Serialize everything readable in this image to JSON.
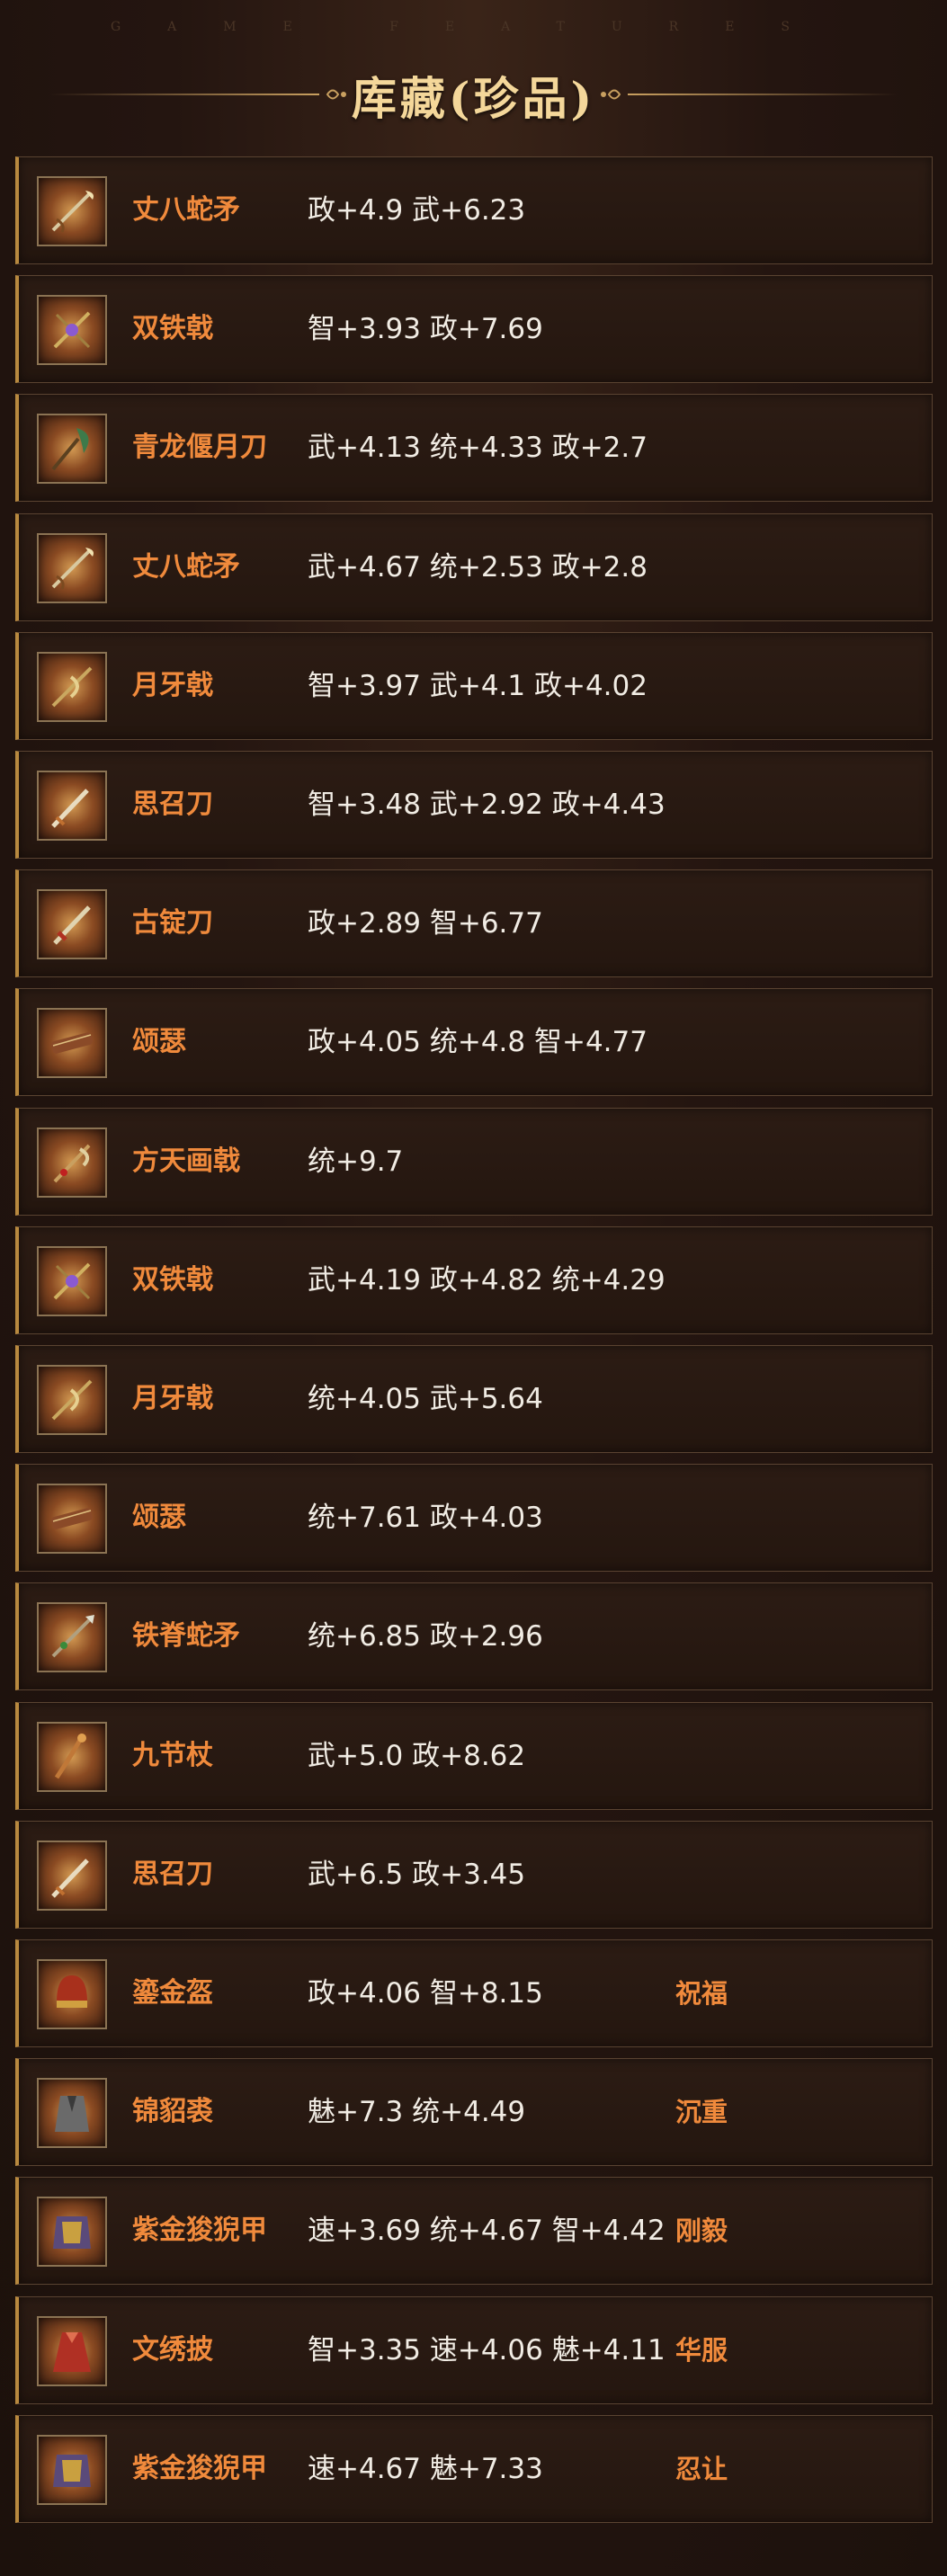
{
  "header": {
    "subtitle": "GAME FEATURES",
    "title": "库藏(珍品)"
  },
  "items": [
    {
      "icon": "snake-spear-icon",
      "name": "丈八蛇矛",
      "stats": "政+4.9 武+6.23",
      "trait": ""
    },
    {
      "icon": "double-halberd-icon",
      "name": "双铁戟",
      "stats": "智+3.93 政+7.69",
      "trait": ""
    },
    {
      "icon": "glaive-icon",
      "name": "青龙偃月刀",
      "stats": "武+4.13 统+4.33 政+2.7",
      "trait": ""
    },
    {
      "icon": "snake-spear-icon",
      "name": "丈八蛇矛",
      "stats": "武+4.67 统+2.53 政+2.8",
      "trait": ""
    },
    {
      "icon": "crescent-halberd-icon",
      "name": "月牙戟",
      "stats": "智+3.97 武+4.1 政+4.02",
      "trait": ""
    },
    {
      "icon": "saber-icon",
      "name": "思召刀",
      "stats": "智+3.48 武+2.92 政+4.43",
      "trait": ""
    },
    {
      "icon": "ancient-blade-icon",
      "name": "古锭刀",
      "stats": "政+2.89 智+6.77",
      "trait": ""
    },
    {
      "icon": "zither-icon",
      "name": "颂瑟",
      "stats": "政+4.05 统+4.8 智+4.77",
      "trait": ""
    },
    {
      "icon": "sky-halberd-icon",
      "name": "方天画戟",
      "stats": "统+9.7",
      "trait": ""
    },
    {
      "icon": "double-halberd-icon",
      "name": "双铁戟",
      "stats": "武+4.19 政+4.82 统+4.29",
      "trait": ""
    },
    {
      "icon": "crescent-halberd-icon",
      "name": "月牙戟",
      "stats": "统+4.05 武+5.64",
      "trait": ""
    },
    {
      "icon": "zither-icon",
      "name": "颂瑟",
      "stats": "统+7.61 政+4.03",
      "trait": ""
    },
    {
      "icon": "iron-spear-icon",
      "name": "铁脊蛇矛",
      "stats": "统+6.85 政+2.96",
      "trait": ""
    },
    {
      "icon": "staff-icon",
      "name": "九节杖",
      "stats": "武+5.0 政+8.62",
      "trait": ""
    },
    {
      "icon": "saber-icon",
      "name": "思召刀",
      "stats": "武+6.5 政+3.45",
      "trait": ""
    },
    {
      "icon": "helmet-icon",
      "name": "鎏金盔",
      "stats": "政+4.06 智+8.15",
      "trait": "祝福"
    },
    {
      "icon": "fur-robe-icon",
      "name": "锦貂裘",
      "stats": "魅+7.3 统+4.49",
      "trait": "沉重"
    },
    {
      "icon": "armor-icon",
      "name": "紫金狻猊甲",
      "stats": "速+3.69 统+4.67 智+4.42",
      "trait": "刚毅"
    },
    {
      "icon": "cape-icon",
      "name": "文绣披",
      "stats": "智+3.35 速+4.06 魅+4.11",
      "trait": "华服"
    },
    {
      "icon": "armor-icon",
      "name": "紫金狻猊甲",
      "stats": "速+4.67 魅+7.33",
      "trait": "忍让"
    }
  ]
}
